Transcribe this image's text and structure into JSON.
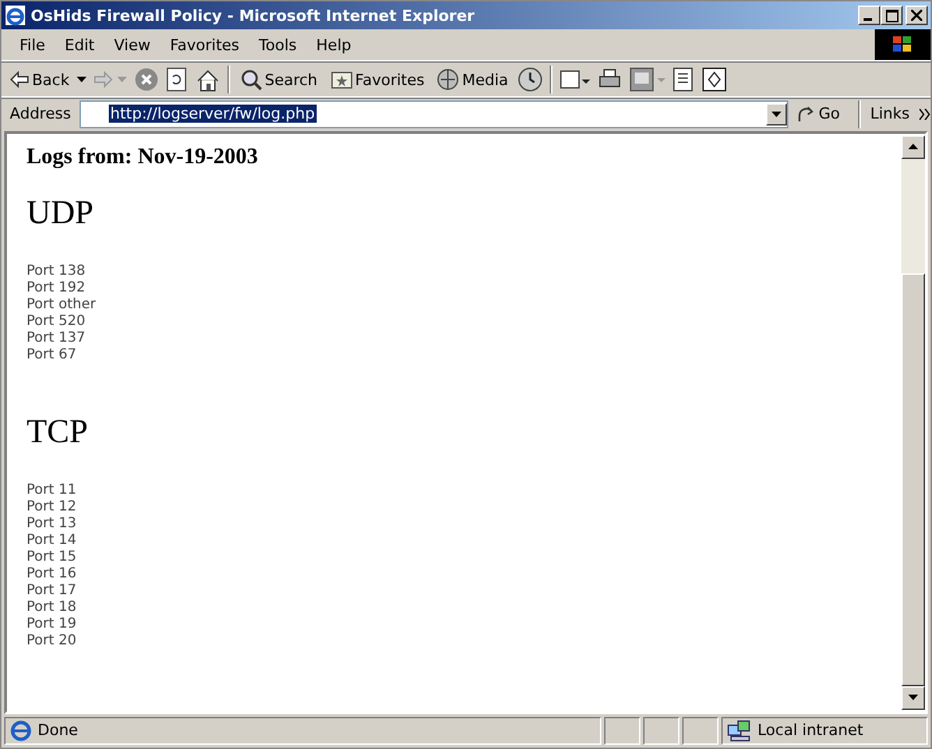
{
  "window": {
    "title": "OsHids Firewall Policy - Microsoft Internet Explorer"
  },
  "menu": [
    "File",
    "Edit",
    "View",
    "Favorites",
    "Tools",
    "Help"
  ],
  "toolbar": {
    "back": "Back",
    "search": "Search",
    "favorites": "Favorites",
    "media": "Media"
  },
  "address": {
    "label": "Address",
    "value": "http://logserver/fw/log.php",
    "go": "Go",
    "links": "Links"
  },
  "page": {
    "heading": "Logs from: Nov-19-2003",
    "sections": [
      {
        "title": "UDP",
        "ports": [
          "Port 138",
          "Port 192",
          "Port other",
          "Port 520",
          "Port 137",
          "Port 67"
        ]
      },
      {
        "title": "TCP",
        "ports": [
          "Port 11",
          "Port 12",
          "Port 13",
          "Port 14",
          "Port 15",
          "Port 16",
          "Port 17",
          "Port 18",
          "Port 19",
          "Port 20"
        ]
      }
    ]
  },
  "status_bar": {
    "text": "Done",
    "zone": "Local intranet"
  }
}
